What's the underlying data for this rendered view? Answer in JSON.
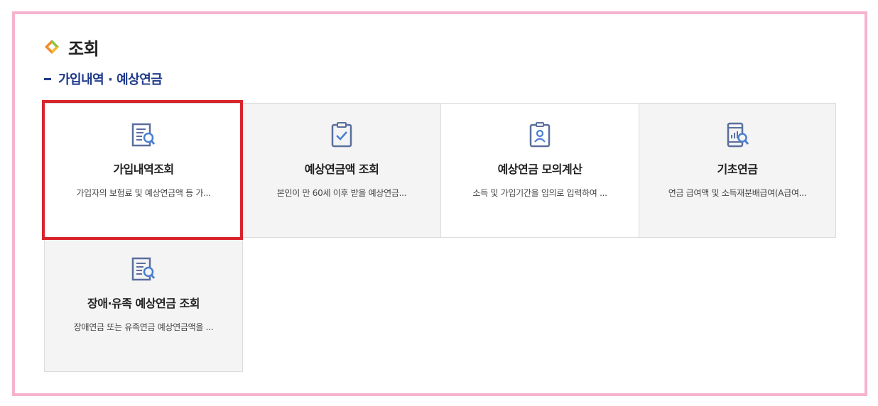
{
  "section": {
    "title": "조회",
    "icon": "diamond-icon"
  },
  "subsection": {
    "title": "가입내역 · 예상연금"
  },
  "cards": [
    {
      "title": "가입내역조회",
      "desc": "가입자의 보험료 및 예상연금액 등 가...",
      "icon": "document-search-icon"
    },
    {
      "title": "예상연금액 조회",
      "desc": "본인이 만 60세 이후 받을 예상연금...",
      "icon": "clipboard-check-icon"
    },
    {
      "title": "예상연금 모의계산",
      "desc": "소득 및 가입기간을 임의로 입력하여 ...",
      "icon": "id-card-icon"
    },
    {
      "title": "기초연금",
      "desc": "연금 급여액 및 소득재분배급여(A급여...",
      "icon": "mobile-chart-search-icon"
    },
    {
      "title": "장애·유족 예상연금 조회",
      "desc": "장애연금 또는 유족연금 예상연금액을 ...",
      "icon": "document-search-icon"
    }
  ],
  "colors": {
    "frame_border": "#f6b3ce",
    "highlight": "#d9232a",
    "subtitle": "#1e3a8a",
    "icon": "#5a6f9e"
  },
  "selected_card": 0
}
